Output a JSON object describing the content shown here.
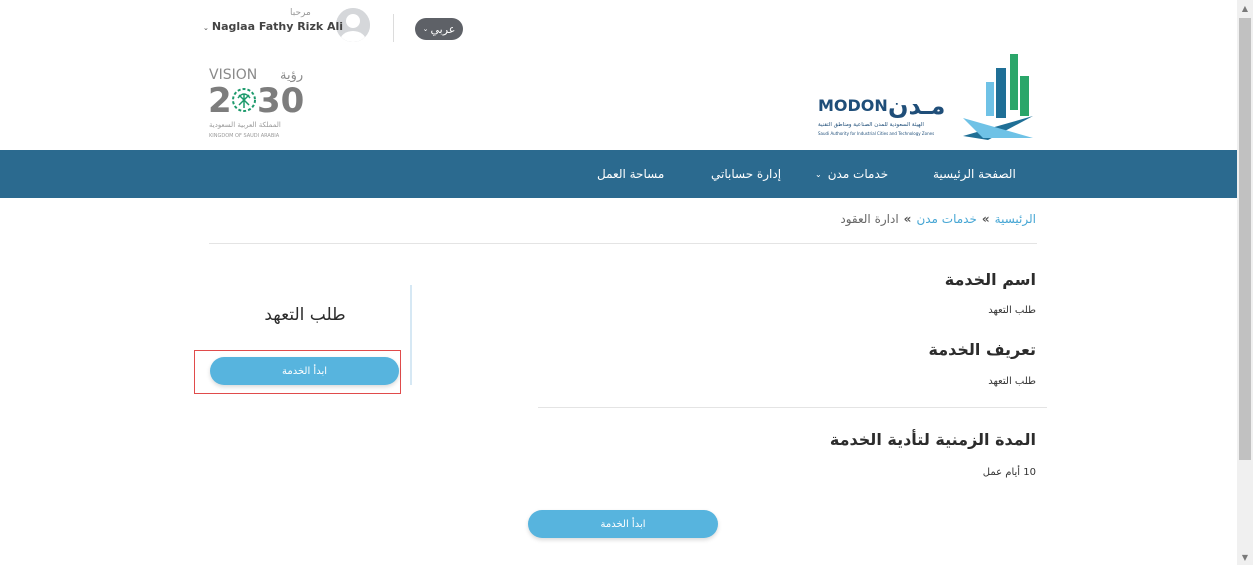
{
  "header": {
    "language_toggle": "عربي",
    "greeting": "مرحبا",
    "user_name": "Naglaa Fathy Rizk Ali"
  },
  "logos": {
    "vision_text": "VISION",
    "vision_arabic": "رؤية",
    "vision_year_left": "2",
    "vision_year_right": "30",
    "vision_kingdom_ar": "المملكة العربية السعودية",
    "vision_kingdom_en": "KINGDOM OF SAUDI ARABIA",
    "modon_en": "MODON",
    "modon_ar": "مـدن",
    "modon_sub_ar": "الهيئة السعودية للمدن الصناعية ومناطق التقنية",
    "modon_sub_en": "Saudi Authority for Industrial Cities and Technology Zones"
  },
  "nav": {
    "home": "الصفحة الرئيسية",
    "services": "خدمات مدن",
    "accounts": "إدارة حساباتي",
    "workspace": "مساحة العمل"
  },
  "breadcrumb": {
    "home": "الرئيسية",
    "services": "خدمات مدن",
    "current": "ادارة العقود",
    "separator": "»"
  },
  "service": {
    "name_heading": "اسم الخدمة",
    "name_value": "طلب التعهد",
    "definition_heading": "تعريف الخدمة",
    "definition_value": "طلب التعهد",
    "duration_heading": "المدة الزمنية لتأدية الخدمة",
    "duration_value": "10 أيام عمل"
  },
  "card": {
    "title": "طلب التعهد",
    "start_button": "ابدأ الخدمة"
  },
  "bottom": {
    "start_button": "ابدأ الخدمة"
  },
  "colors": {
    "navbar": "#2b6a8f",
    "button": "#57b4de",
    "link": "#46a6d4",
    "highlight": "#e04b4b"
  }
}
